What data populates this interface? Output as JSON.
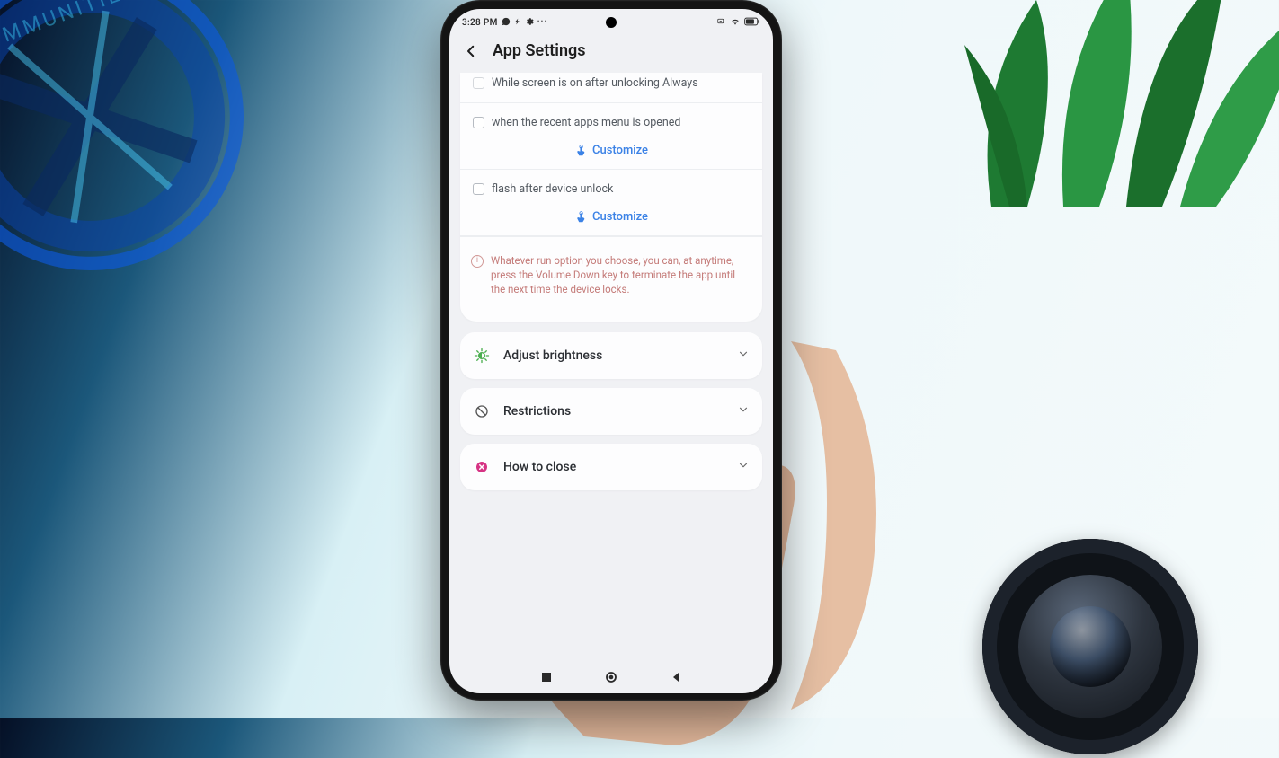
{
  "status_bar": {
    "time": "3:28 PM",
    "icons_left": [
      "whatsapp",
      "bolt",
      "gear",
      "more"
    ],
    "icons_right": [
      "volume",
      "wifi",
      "battery"
    ]
  },
  "header": {
    "title": "App Settings"
  },
  "options": {
    "opt_screen_on": {
      "label": "While screen is on after unlocking Always"
    },
    "opt_recent": {
      "label": "when the recent apps menu is opened",
      "customize": "Customize"
    },
    "opt_flash": {
      "label": "flash after device unlock",
      "customize": "Customize"
    }
  },
  "note_text": "Whatever run option you choose, you can, at anytime, press the Volume Down key to terminate the app until the next time the device locks.",
  "accordions": {
    "brightness": {
      "label": "Adjust brightness"
    },
    "restrictions": {
      "label": "Restrictions"
    },
    "how_close": {
      "label": "How to close"
    }
  }
}
